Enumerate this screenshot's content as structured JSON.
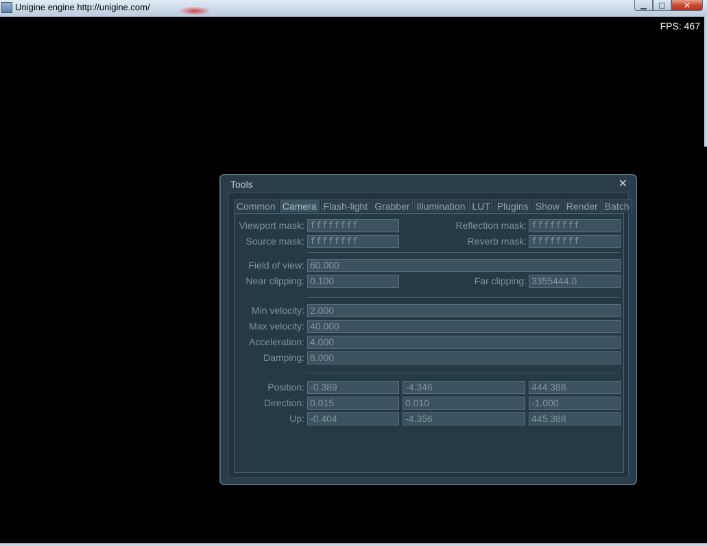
{
  "window": {
    "title": "Unigine engine http://unigine.com/",
    "fps": "FPS: 467"
  },
  "tools": {
    "title": "Tools",
    "tabs": [
      "Common",
      "Camera",
      "Flash-light",
      "Grabber",
      "Illumination",
      "LUT",
      "Plugins",
      "Show",
      "Render",
      "Batch"
    ],
    "active_tab": "Camera",
    "viewport_mask_label": "Viewport mask:",
    "viewport_mask": "ffffffff",
    "reflection_mask_label": "Reflection mask:",
    "reflection_mask": "ffffffff",
    "source_mask_label": "Source mask:",
    "source_mask": "ffffffff",
    "reverb_mask_label": "Reverb mask:",
    "reverb_mask": "ffffffff",
    "fov_label": "Field of view:",
    "fov": "60.000",
    "near_label": "Near clipping:",
    "near": "0.100",
    "far_label": "Far clipping:",
    "far": "3355444.0",
    "min_velocity_label": "Min velocity:",
    "min_velocity": "2.000",
    "max_velocity_label": "Max velocity:",
    "max_velocity": "40.000",
    "acceleration_label": "Acceleration:",
    "acceleration": "4.000",
    "damping_label": "Damping:",
    "damping": "8.000",
    "position_label": "Position:",
    "position": [
      "-0.389",
      "-4.346",
      "444.388"
    ],
    "direction_label": "Direction:",
    "direction": [
      "0.015",
      "0.010",
      "-1.000"
    ],
    "up_label": "Up:",
    "up": [
      "-0.404",
      "-4.356",
      "445.388"
    ]
  }
}
